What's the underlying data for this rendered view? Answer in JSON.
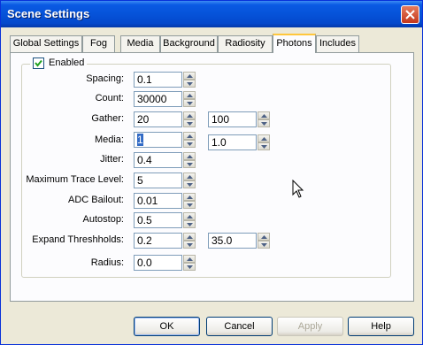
{
  "window": {
    "title": "Scene Settings"
  },
  "tabs": [
    {
      "label": "Global Settings",
      "active": false
    },
    {
      "label": "Fog",
      "active": false
    },
    {
      "label": "Media",
      "active": false
    },
    {
      "label": "Background",
      "active": false
    },
    {
      "label": "Radiosity",
      "active": false
    },
    {
      "label": "Photons",
      "active": true
    },
    {
      "label": "Includes",
      "active": false
    }
  ],
  "enabled": {
    "label": "Enabled",
    "checked": true
  },
  "fields": {
    "spacing": {
      "label": "Spacing:",
      "value": "0.1"
    },
    "count": {
      "label": "Count:",
      "value": "30000"
    },
    "gather": {
      "label": "Gather:",
      "value": "20",
      "value2": "100"
    },
    "media": {
      "label": "Media:",
      "value": "1",
      "value2": "1.0"
    },
    "jitter": {
      "label": "Jitter:",
      "value": "0.4"
    },
    "max_trace": {
      "label": "Maximum Trace Level:",
      "value": "5"
    },
    "adc_bailout": {
      "label": "ADC Bailout:",
      "value": "0.01"
    },
    "autostop": {
      "label": "Autostop:",
      "value": "0.5"
    },
    "expand": {
      "label": "Expand Threshholds:",
      "value": "0.2",
      "value2": "35.0"
    },
    "radius": {
      "label": "Radius:",
      "value": "0.0"
    }
  },
  "buttons": {
    "ok": "OK",
    "cancel": "Cancel",
    "apply": "Apply",
    "help": "Help"
  }
}
